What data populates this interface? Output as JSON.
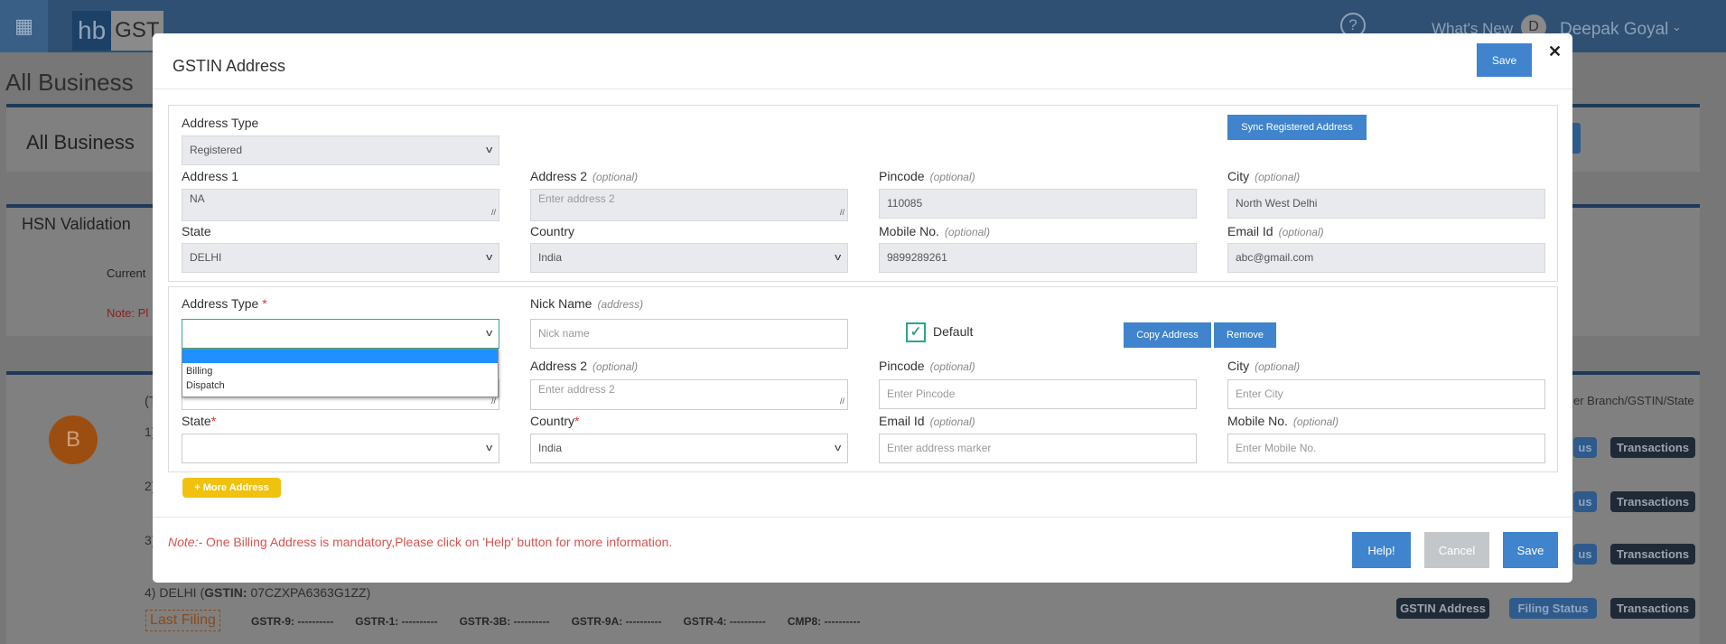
{
  "app": {
    "logo_hb": "hb",
    "logo_gst": "GST",
    "whats_new": "What's New",
    "user_initial": "D",
    "user_name": "Deepak Goyal"
  },
  "background": {
    "page_title": "All Business",
    "panel1_title": "All Business",
    "hsn_title": "HSN Validation",
    "hsn_current": "Current",
    "hsn_note": "Note: Pl",
    "avatar": "B",
    "list_header": "(T",
    "filter_text": "er Branch/GSTIN/State",
    "rows": [
      {
        "num": "1)"
      },
      {
        "num": "2)"
      },
      {
        "num": "3)"
      },
      {
        "num": "4) DELHI (",
        "gstin_label": "GSTIN:",
        "gstin": " 07CZXPA6363G1ZZ)"
      }
    ],
    "last_filing": "Last Filing",
    "filings": [
      "GSTR-9: ----------",
      "GSTR-1: ----------",
      "GSTR-3B: ----------",
      "GSTR-9A: ----------",
      "GSTR-4: ----------",
      "CMP8: ----------"
    ],
    "btn_gstin_address": "GSTIN Address",
    "btn_filing_status": "Filing Status",
    "btn_filing_status_partial": "us",
    "btn_transactions": "Transactions"
  },
  "modal": {
    "title": "GSTIN Address",
    "save_top": "Save",
    "close": "✕",
    "registered": {
      "sync_button": "Sync Registered Address",
      "address_type_label": "Address Type",
      "address_type_value": "Registered",
      "address1_label": "Address 1",
      "address1_value": "NA",
      "address2_label": "Address 2",
      "address2_placeholder": "Enter address 2",
      "pincode_label": "Pincode",
      "pincode_value": "110085",
      "city_label": "City",
      "city_value": "North West Delhi",
      "state_label": "State",
      "state_value": "DELHI",
      "country_label": "Country",
      "country_value": "India",
      "mobile_label": "Mobile No.",
      "mobile_value": "9899289261",
      "email_label": "Email Id",
      "email_value": "abc@gmail.com"
    },
    "optional": "(optional)",
    "new_address": {
      "address_type_label": "Address Type",
      "required": "*",
      "dropdown_options": [
        "",
        "Billing",
        "Dispatch"
      ],
      "nick_label": "Nick Name",
      "nick_hint": "(address)",
      "nick_placeholder": "Nick name",
      "default_label": "Default",
      "default_checked": true,
      "copy_button": "Copy Address",
      "remove_button": "Remove",
      "address2_label": "Address 2",
      "address2_placeholder": "Enter address 2",
      "pincode_label": "Pincode",
      "pincode_placeholder": "Enter Pincode",
      "city_label": "City",
      "city_placeholder": "Enter City",
      "state_label": "State",
      "country_label": "Country",
      "country_value": "India",
      "email_label": "Email Id",
      "email_placeholder": "Enter address marker",
      "mobile_label": "Mobile No.",
      "mobile_placeholder": "Enter Mobile No."
    },
    "more_address": "+ More Address",
    "note_prefix": "Note:-",
    "note_text": " One Billing Address is mandatory,Please click on 'Help' button for more information.",
    "help": "Help!",
    "cancel": "Cancel",
    "save": "Save"
  }
}
